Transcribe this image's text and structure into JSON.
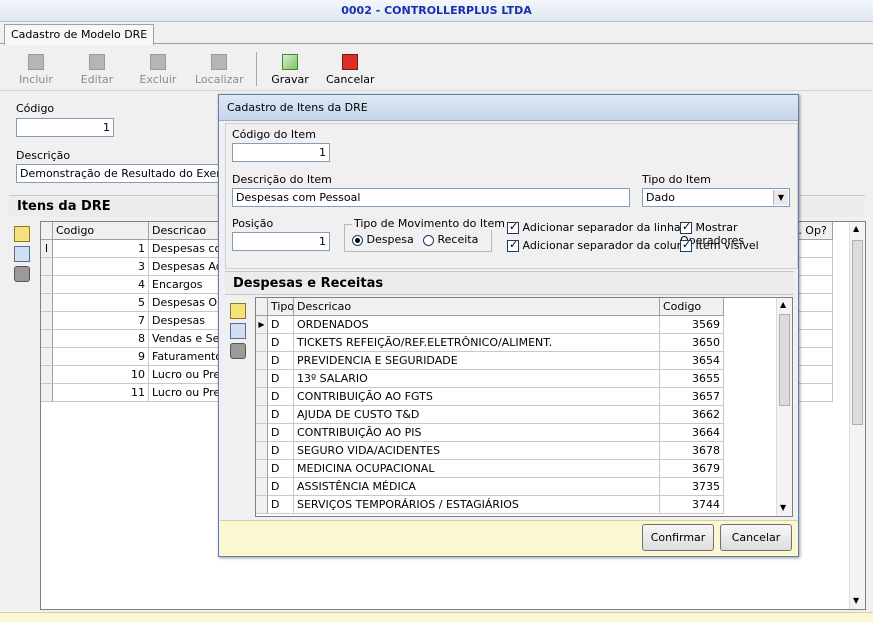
{
  "window": {
    "title": "0002 - CONTROLLERPLUS LTDA"
  },
  "tab": {
    "label": "Cadastro de Modelo DRE"
  },
  "toolbar": {
    "incluir": "Incluir",
    "editar": "Editar",
    "excluir": "Excluir",
    "localizar": "Localizar",
    "gravar": "Gravar",
    "cancelar": "Cancelar"
  },
  "form": {
    "codigo_label": "Código",
    "codigo_value": "1",
    "descricao_label": "Descrição",
    "descricao_value": "Demonstração de Resultado do Exercicio"
  },
  "itens": {
    "title": "Itens da DRE",
    "col_codigo": "Codigo",
    "col_descricao": "Descricao",
    "col_extra": "t. Op?",
    "rows": [
      {
        "codigo": "1",
        "descricao": "Despesas com Pessoal"
      },
      {
        "codigo": "3",
        "descricao": "Despesas Administrativas"
      },
      {
        "codigo": "4",
        "descricao": "Encargos"
      },
      {
        "codigo": "5",
        "descricao": "Despesas Operacionais"
      },
      {
        "codigo": "7",
        "descricao": "Despesas"
      },
      {
        "codigo": "8",
        "descricao": "Vendas e Serviços Prestados"
      },
      {
        "codigo": "9",
        "descricao": "Faturamento Bruto"
      },
      {
        "codigo": "10",
        "descricao": "Lucro ou Prejuizo Bruto"
      },
      {
        "codigo": "11",
        "descricao": "Lucro ou Prejuizo Liquido"
      }
    ]
  },
  "dialog": {
    "title": "Cadastro de Itens da DRE",
    "codigo_item_label": "Código do Item",
    "codigo_item_value": "1",
    "descricao_item_label": "Descrição do Item",
    "descricao_item_value": "Despesas com Pessoal",
    "tipo_item_label": "Tipo do Item",
    "tipo_item_value": "Dado",
    "posicao_label": "Posição",
    "posicao_value": "1",
    "tipo_mov_label": "Tipo de Movimento do Item",
    "radio_despesa": "Despesa",
    "radio_receita": "Receita",
    "chk_sep_linha": "Adicionar separador da linha",
    "chk_sep_coluna": "Adicionar separador da coluna",
    "chk_mostrar_op": "Mostrar Operadores",
    "chk_item_visivel": "Item visível",
    "section_title": "Despesas e Receitas",
    "col_tipo": "Tipo",
    "col_descricao": "Descricao",
    "col_codigo": "Codigo",
    "rows": [
      {
        "tipo": "D",
        "descricao": "ORDENADOS",
        "codigo": "3569"
      },
      {
        "tipo": "D",
        "descricao": "TICKETS REFEIÇÃO/REF.ELETRÔNICO/ALIMENT.",
        "codigo": "3650"
      },
      {
        "tipo": "D",
        "descricao": "PREVIDENCIA E SEGURIDADE",
        "codigo": "3654"
      },
      {
        "tipo": "D",
        "descricao": "13º SALARIO",
        "codigo": "3655"
      },
      {
        "tipo": "D",
        "descricao": "CONTRIBUIÇÃO AO FGTS",
        "codigo": "3657"
      },
      {
        "tipo": "D",
        "descricao": "AJUDA DE CUSTO T&D",
        "codigo": "3662"
      },
      {
        "tipo": "D",
        "descricao": "CONTRIBUIÇÃO AO PIS",
        "codigo": "3664"
      },
      {
        "tipo": "D",
        "descricao": "SEGURO VIDA/ACIDENTES",
        "codigo": "3678"
      },
      {
        "tipo": "D",
        "descricao": "MEDICINA OCUPACIONAL",
        "codigo": "3679"
      },
      {
        "tipo": "D",
        "descricao": "ASSISTÊNCIA MÉDICA",
        "codigo": "3735"
      },
      {
        "tipo": "D",
        "descricao": "SERVIÇOS TEMPORÁRIOS / ESTAGIÁRIOS",
        "codigo": "3744"
      }
    ],
    "confirmar": "Confirmar",
    "cancelar": "Cancelar"
  }
}
